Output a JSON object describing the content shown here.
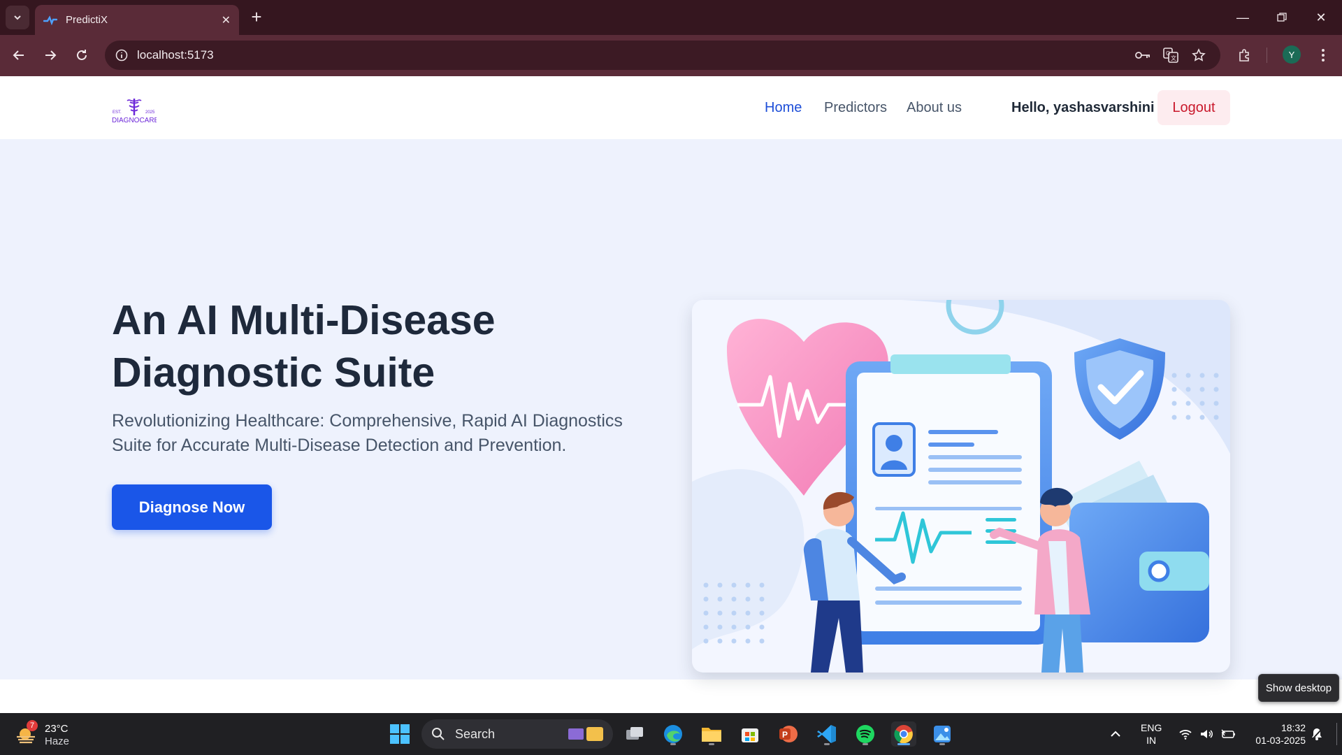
{
  "browser": {
    "tab_title": "PredictiX",
    "url": "localhost:5173",
    "profile_initial": "Y"
  },
  "nav": {
    "logo_est": "EST.",
    "logo_year": "2025",
    "logo_text": "DIAGNOCARE",
    "links": [
      "Home",
      "Predictors",
      "About us"
    ],
    "active_link": "Home",
    "greeting": "Hello, yashasvarshini",
    "logout_label": "Logout"
  },
  "hero": {
    "title_line1": "An AI Multi-Disease",
    "title_line2": "Diagnostic Suite",
    "subtitle": "Revolutionizing Healthcare: Comprehensive, Rapid AI Diagnostics Suite for Accurate Multi-Disease Detection and Prevention.",
    "cta_label": "Diagnose Now"
  },
  "taskbar": {
    "weather_temp": "23°C",
    "weather_cond": "Haze",
    "weather_badge": "7",
    "search_label": "Search",
    "lang_top": "ENG",
    "lang_bottom": "IN",
    "time": "18:32",
    "date": "01-03-2025",
    "tooltip": "Show desktop"
  },
  "colors": {
    "accent": "#1a56e8",
    "logout_text": "#c9182b",
    "hero_bg": "#eef2fd",
    "chrome_bg": "#5a2b38"
  }
}
